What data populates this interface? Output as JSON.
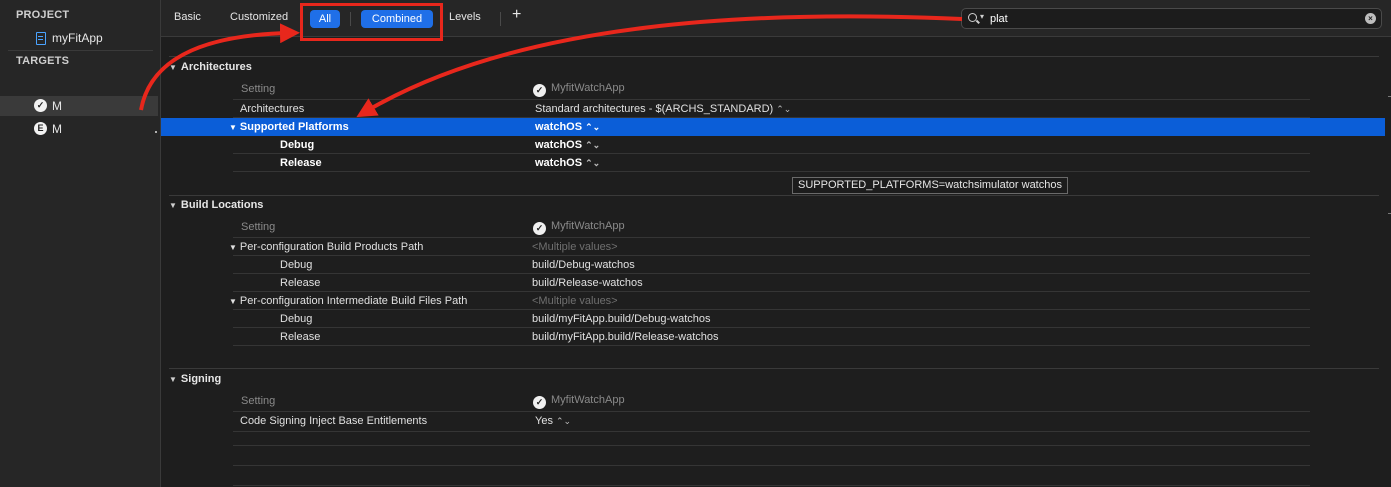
{
  "navigator": {
    "project_header": "PROJECT",
    "project_item": "myFitApp",
    "targets_header": "TARGETS",
    "targets": [
      {
        "label": "M",
        "icon": "watch-app-icon"
      },
      {
        "label": "M",
        "icon": "extension-icon",
        "icon_text": "E"
      }
    ]
  },
  "toolbar": {
    "tabs": [
      "Basic",
      "Customized"
    ],
    "pill_all": "All",
    "pill_combined": "Combined",
    "levels": "Levels",
    "add": "+",
    "search_value": "plat",
    "clear": "×"
  },
  "sections": {
    "architectures": {
      "title": "Architectures",
      "setting_header": "Setting",
      "target_header": "MyfitWatchApp",
      "rows": [
        {
          "name": "Architectures",
          "value": "Standard architectures  -  $(ARCHS_STANDARD)"
        },
        {
          "name": "Supported Platforms",
          "value": "watchOS"
        },
        {
          "name": "Debug",
          "value": "watchOS"
        },
        {
          "name": "Release",
          "value": "watchOS"
        }
      ],
      "tooltip": "SUPPORTED_PLATFORMS=watchsimulator watchos"
    },
    "build_locations": {
      "title": "Build Locations",
      "setting_header": "Setting",
      "target_header": "MyfitWatchApp",
      "rows": [
        {
          "name": "Per-configuration Build Products Path",
          "value": "<Multiple values>"
        },
        {
          "name": "Debug",
          "value": "build/Debug-watchos"
        },
        {
          "name": "Release",
          "value": "build/Release-watchos"
        },
        {
          "name": "Per-configuration Intermediate Build Files Path",
          "value": "<Multiple values>"
        },
        {
          "name": "Debug",
          "value": "build/myFitApp.build/Debug-watchos"
        },
        {
          "name": "Release",
          "value": "build/myFitApp.build/Release-watchos"
        }
      ]
    },
    "signing": {
      "title": "Signing",
      "setting_header": "Setting",
      "target_header": "MyfitWatchApp",
      "rows": [
        {
          "name": "Code Signing Inject Base Entitlements",
          "value": "Yes"
        }
      ]
    }
  },
  "colors": {
    "accent": "#1f6fe8",
    "selection": "#0b5ed8",
    "annotation": "#e8271c",
    "background": "#1e1e1e"
  }
}
